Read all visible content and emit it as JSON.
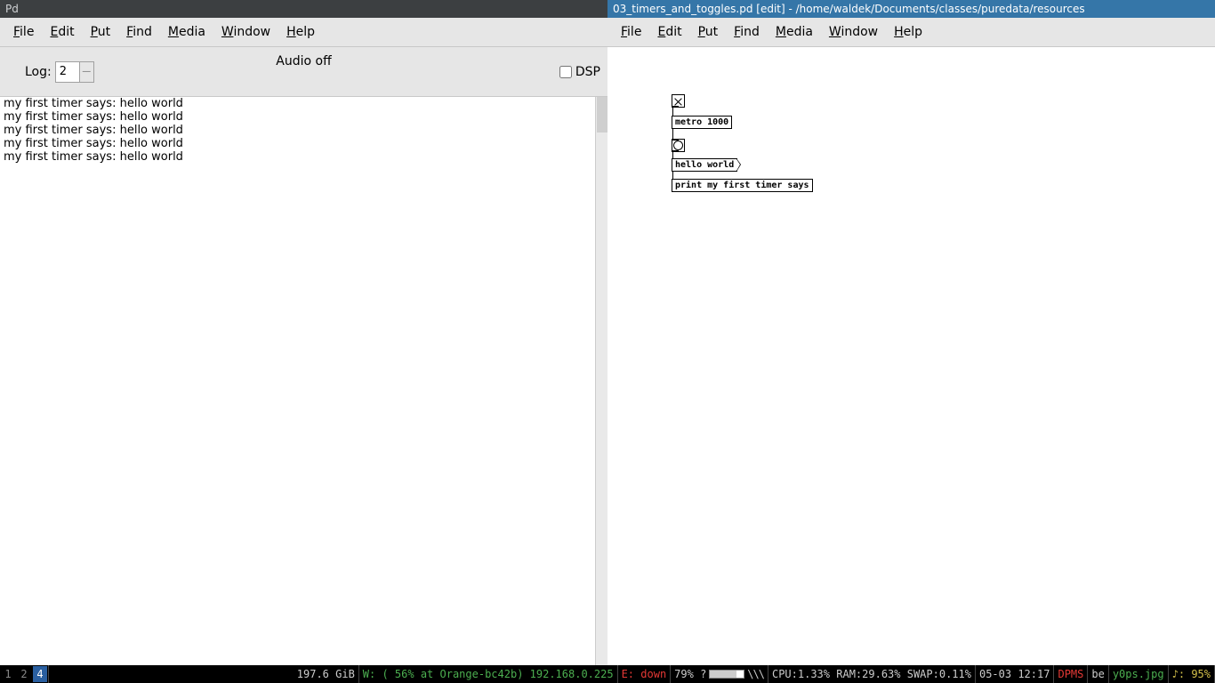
{
  "left_window": {
    "title": "Pd",
    "menu": [
      "File",
      "Edit",
      "Put",
      "Find",
      "Media",
      "Window",
      "Help"
    ],
    "toolbar": {
      "log_label": "Log:",
      "log_value": "2",
      "audio_status": "Audio off",
      "dsp_label": "DSP",
      "dsp_checked": false
    },
    "console_lines": [
      "my first timer says: hello world",
      "my first timer says: hello world",
      "my first timer says: hello world",
      "my first timer says: hello world",
      "my first timer says: hello world"
    ]
  },
  "right_window": {
    "title": "03_timers_and_toggles.pd  [edit]  -  /home/waldek/Documents/classes/puredata/resources",
    "menu": [
      "File",
      "Edit",
      "Put",
      "Find",
      "Media",
      "Window",
      "Help"
    ],
    "patch": {
      "metro_text": "metro 1000",
      "msg_text": "hello world",
      "print_text": "print my first timer says"
    }
  },
  "statusbar": {
    "workspaces": [
      "1",
      "2",
      "4"
    ],
    "workspace_active": 2,
    "disk": "197.6 GiB",
    "wifi_label": "W:",
    "wifi_text": "( 56% at Orange-bc42b) 192.168.0.225",
    "eth_label": "E:",
    "eth_text": "down",
    "bat_pct": "79% ?",
    "bat_fill": 79,
    "hatch": "\\\\\\",
    "cpu": "CPU:1.33%",
    "ram": "RAM:29.63%",
    "swap": "SWAP:0.11%",
    "datetime": "05-03 12:17",
    "dpms": "DPMS",
    "kb": "be",
    "file": "y0ps.jpg",
    "vol_icon": "♪:",
    "vol": "95%"
  }
}
